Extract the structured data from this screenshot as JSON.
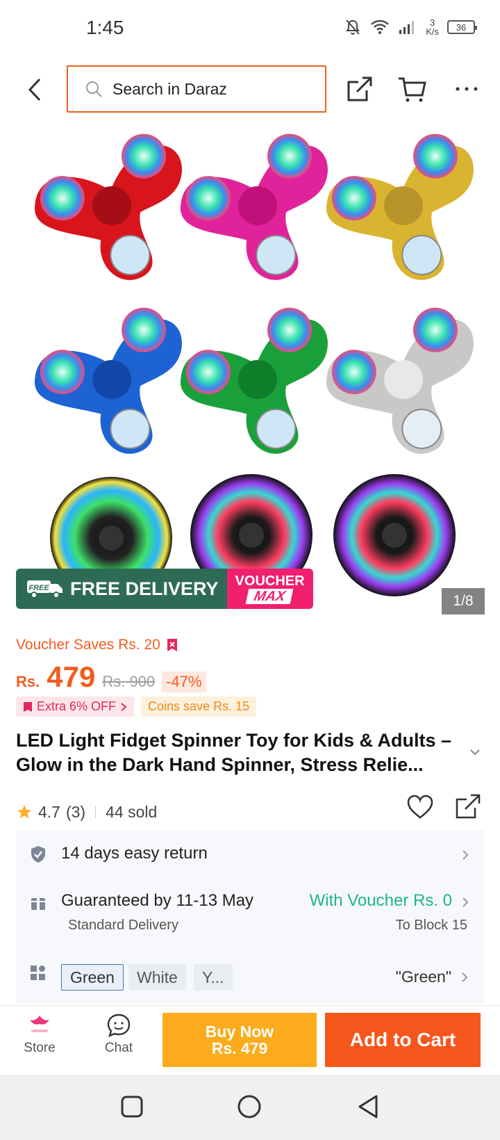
{
  "status_bar": {
    "time": "1:45",
    "net_speed_value": "3",
    "net_speed_unit": "K/s",
    "battery": "36"
  },
  "header": {
    "search_placeholder": "Search in Daraz"
  },
  "gallery": {
    "promo_free_delivery": "FREE DELIVERY",
    "promo_free_tag": "FREE",
    "promo_voucher": "VOUCHER",
    "promo_max": "MAX",
    "page_counter": "1/8",
    "spinner_colors": [
      "#d8141c",
      "#e0239a",
      "#d9b431",
      "#1d63d4",
      "#1aa03a",
      "#c8c8c8"
    ]
  },
  "product": {
    "voucher_saves": "Voucher Saves Rs. 20",
    "price_currency": "Rs.",
    "price": "479",
    "original_price": "Rs. 900",
    "discount": "-47%",
    "extra_offer": "Extra 6% OFF",
    "coins_offer": "Coins save Rs. 15",
    "title": "LED Light Fidget Spinner Toy for Kids & Adults – Glow in the Dark Hand Spinner, Stress Relie...",
    "rating": "4.7",
    "rating_count": "(3)",
    "sold": "44 sold"
  },
  "services": {
    "return_policy": "14 days easy return",
    "delivery_guarantee": "Guaranteed by 11-13 May",
    "delivery_type": "Standard Delivery",
    "voucher_delivery": "With Voucher Rs. 0",
    "delivery_location": "To Block 15",
    "variants": [
      "Green",
      "White",
      "Y..."
    ],
    "selected_variant": "\"Green\""
  },
  "bottom_bar": {
    "store_label": "Store",
    "chat_label": "Chat",
    "buy_now_label": "Buy Now",
    "buy_now_price": "Rs. 479",
    "add_to_cart_label": "Add to Cart"
  },
  "colors": {
    "accent": "#f25c1f",
    "teal": "#1eb58f",
    "buy_now": "#fbab1b",
    "add_to_cart": "#f7561c"
  }
}
